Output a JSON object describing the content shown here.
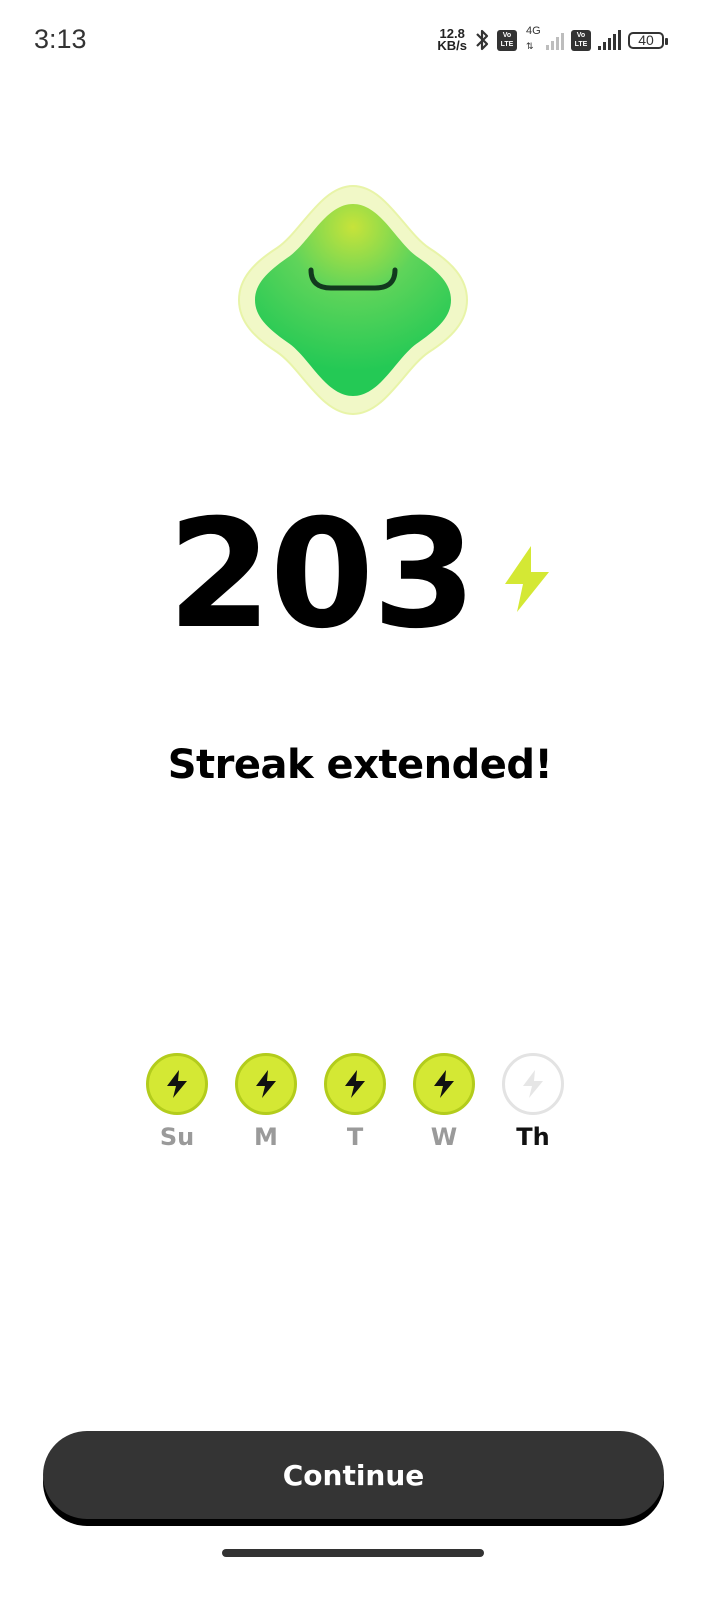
{
  "status_bar": {
    "time": "3:13",
    "net_speed_value": "12.8",
    "net_speed_unit": "KB/s",
    "volte_top": "Vo",
    "volte_bottom": "LTE",
    "network_type": "4G",
    "battery": "40"
  },
  "streak": {
    "count": "203",
    "headline": "Streak extended!"
  },
  "week": [
    {
      "label": "Su",
      "done": true
    },
    {
      "label": "M",
      "done": true
    },
    {
      "label": "T",
      "done": true
    },
    {
      "label": "W",
      "done": true
    },
    {
      "label": "Th",
      "done": false
    }
  ],
  "actions": {
    "continue_label": "Continue"
  },
  "colors": {
    "accent": "#d4e834",
    "mascot_green": "#2ecc55",
    "button": "#343434"
  }
}
